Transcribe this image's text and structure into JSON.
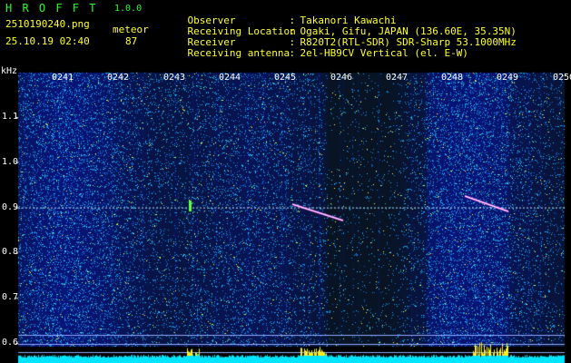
{
  "header": {
    "app_name": "H R O F F T",
    "version": "1.0.0",
    "filename": "2510190240.png",
    "timestamp": "25.10.19 02:40",
    "meteor_label": "meteor",
    "meteor_count": "87",
    "info": [
      {
        "label": "Observer",
        "value": "Takanori Kawachi"
      },
      {
        "label": "Receiving Location",
        "value": "Ogaki, Gifu, JAPAN (136.60E, 35.35N)"
      },
      {
        "label": "Receiver",
        "value": "R820T2(RTL-SDR) SDR-Sharp 53.1000MHz"
      },
      {
        "label": "Receiving antenna",
        "value": "2el-HB9CV Vertical (el. E-W)"
      }
    ]
  },
  "spectrogram": {
    "y_unit": "kHz",
    "y_ticks": [
      "1.1",
      "1.0",
      "0.9",
      "0.8",
      "0.7",
      "0.6"
    ],
    "x_ticks": [
      "0241",
      "0242",
      "0243",
      "0244",
      "0245",
      "0246",
      "0247",
      "0248",
      "0249",
      "0250"
    ],
    "ylim_khz": [
      0.58,
      1.2
    ],
    "carrier_khz": 0.9,
    "colors": {
      "background": "#000000",
      "noise_base": "#0a1a7a",
      "noise_bright": "#3aa0ff",
      "carrier": "#bfe8ff",
      "power_bar": "#00e5ff",
      "power_peak": "#ffee22",
      "meteor": "#ff55ff"
    }
  }
}
